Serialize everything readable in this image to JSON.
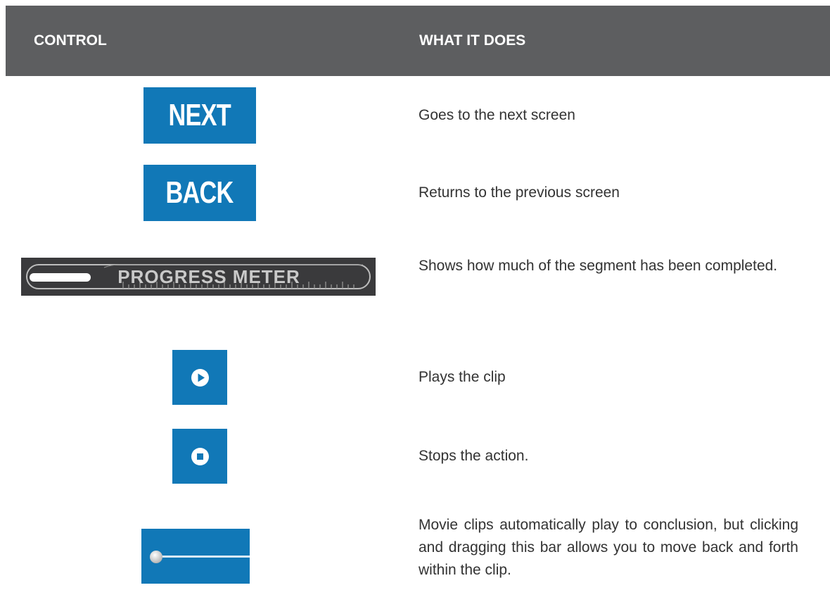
{
  "header": {
    "col1": "CONTROL",
    "col2": "WHAT IT DOES"
  },
  "rows": [
    {
      "control": "NEXT",
      "icon": "next-button",
      "description": "Goes to the next screen"
    },
    {
      "control": "BACK",
      "icon": "back-button",
      "description": "Returns to the previous screen"
    },
    {
      "control": "PROGRESS METER",
      "icon": "progress-meter",
      "progress": 0.18,
      "description": "Shows how much of the segment has been completed."
    },
    {
      "icon": "play-icon",
      "description": "Plays the clip"
    },
    {
      "icon": "stop-icon",
      "description": "Stops the action."
    },
    {
      "icon": "scrubber-bar",
      "position": 0.0,
      "description": "Movie clips automatically play to conclusion, but clicking and dragging this bar allows you to move back and forth within the clip."
    }
  ],
  "colors": {
    "header_bg": "#5d5e60",
    "button_blue": "#1178b7",
    "meter_bg": "#3a3a3c",
    "text": "#333333"
  }
}
